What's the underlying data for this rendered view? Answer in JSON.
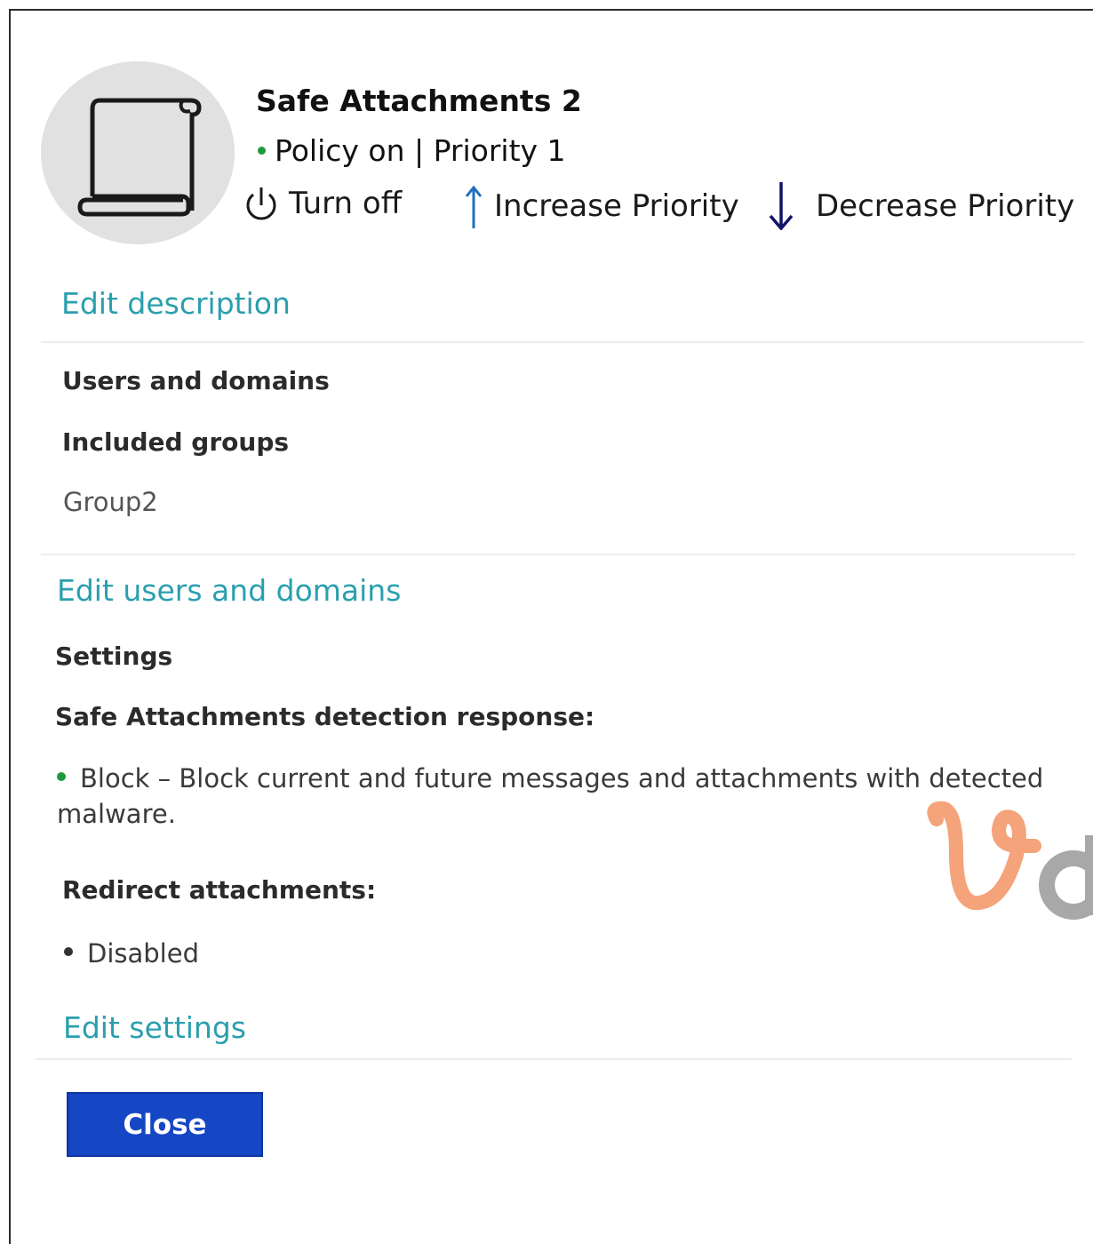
{
  "header": {
    "title": "Safe Attachments 2",
    "status": "Policy on | Priority 1",
    "status_color": "#1f9a3b",
    "icon": "policy-scroll-icon"
  },
  "actions": {
    "turn_off": {
      "label": "Turn off",
      "icon": "power-icon"
    },
    "increase_priority": {
      "label": "Increase Priority",
      "icon": "arrow-up-icon"
    },
    "decrease_priority": {
      "label": "Decrease Priority",
      "icon": "arrow-down-icon"
    }
  },
  "links": {
    "edit_description": "Edit description",
    "edit_users_domains": "Edit users and domains",
    "edit_settings": "Edit settings"
  },
  "users_domains": {
    "heading": "Users and domains",
    "included_groups_label": "Included groups",
    "included_groups_value": "Group2"
  },
  "settings": {
    "heading": "Settings",
    "detection_label": "Safe Attachments detection response:",
    "detection_value": "Block – Block current and future messages and attachments with detected malware.",
    "redirect_label": "Redirect attachments:",
    "redirect_value": "Disabled"
  },
  "footer": {
    "close_label": "Close",
    "accent_color": "#1546c4"
  },
  "colors": {
    "link": "#2a9fae",
    "status_dot": "#1f9a3b"
  }
}
